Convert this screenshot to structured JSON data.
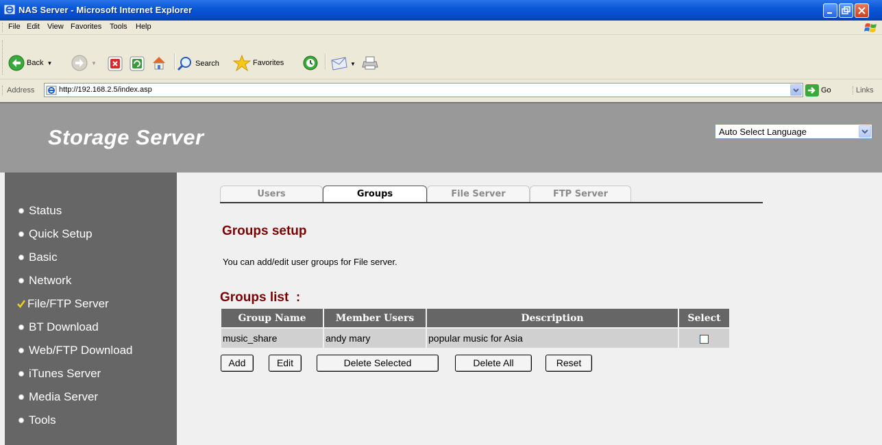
{
  "window": {
    "title": "NAS Server - Microsoft Internet Explorer"
  },
  "menu": [
    "File",
    "Edit",
    "View",
    "Favorites",
    "Tools",
    "Help"
  ],
  "toolbar": {
    "back_label": "Back",
    "search_label": "Search",
    "favorites_label": "Favorites"
  },
  "addressbar": {
    "label": "Address",
    "url": "http://192.168.2.5/index.asp",
    "go_label": "Go",
    "links_label": "Links"
  },
  "header": {
    "brand": "Storage Server",
    "language": "Auto Select Language"
  },
  "sidebar": {
    "items": [
      {
        "label": "Status",
        "icon": "bullet"
      },
      {
        "label": "Quick Setup",
        "icon": "bullet"
      },
      {
        "label": "Basic",
        "icon": "bullet"
      },
      {
        "label": "Network",
        "icon": "bullet"
      },
      {
        "label": "File/FTP Server",
        "icon": "checkmark"
      },
      {
        "label": "BT Download",
        "icon": "bullet"
      },
      {
        "label": "Web/FTP Download",
        "icon": "bullet"
      },
      {
        "label": "iTunes Server",
        "icon": "bullet"
      },
      {
        "label": "Media Server",
        "icon": "bullet"
      },
      {
        "label": "Tools",
        "icon": "bullet"
      }
    ]
  },
  "tabs": [
    "Users",
    "Groups",
    "File Server",
    "FTP Server"
  ],
  "active_tab": "Groups",
  "section": {
    "title": "Groups setup",
    "description": "You can add/edit user groups for File server.",
    "list_title": "Groups list  :"
  },
  "table": {
    "headers": [
      "Group Name",
      "Member Users",
      "Description",
      "Select"
    ],
    "rows": [
      {
        "group": "music_share",
        "members": "andy mary",
        "description": "popular music for Asia",
        "selected": false
      }
    ]
  },
  "buttons": {
    "add": "Add",
    "edit": "Edit",
    "delete_selected": "Delete Selected",
    "delete_all": "Delete All",
    "reset": "Reset"
  },
  "colors": {
    "title_red": "#7a0000",
    "sidebar_bg": "#666666",
    "header_bg": "#999999"
  }
}
